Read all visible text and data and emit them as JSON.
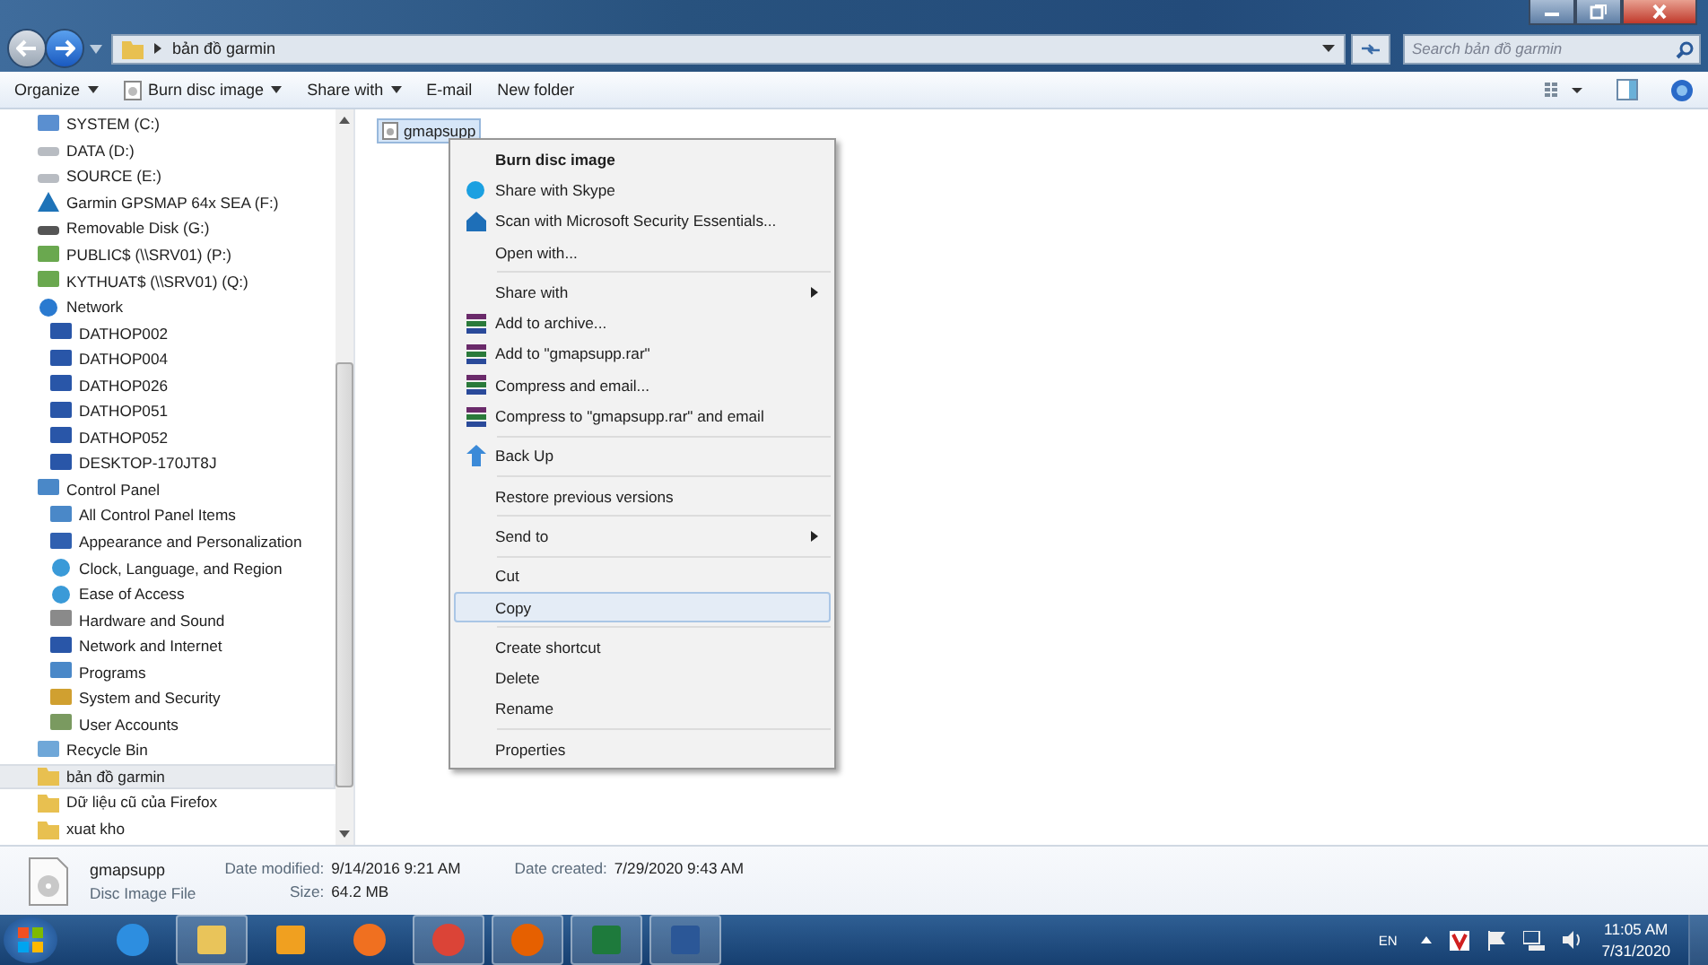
{
  "address": {
    "crumb": "bản đồ garmin",
    "search_placeholder": "Search bản đồ garmin"
  },
  "toolbar": [
    {
      "label": "Organize",
      "dropdown": true,
      "icon": false
    },
    {
      "label": "Burn disc image",
      "dropdown": true,
      "icon": true
    },
    {
      "label": "Share with",
      "dropdown": true,
      "icon": false
    },
    {
      "label": "E-mail",
      "dropdown": false,
      "icon": false
    },
    {
      "label": "New folder",
      "dropdown": false,
      "icon": false
    }
  ],
  "nav": [
    {
      "label": "SYSTEM (C:)",
      "kind": "system",
      "selected": false
    },
    {
      "label": "DATA (D:)",
      "kind": "drive",
      "selected": false
    },
    {
      "label": "SOURCE (E:)",
      "kind": "drive",
      "selected": false
    },
    {
      "label": "Garmin GPSMAP 64x SEA (F:)",
      "kind": "device",
      "selected": false
    },
    {
      "label": "Removable Disk (G:)",
      "kind": "removable",
      "selected": false
    },
    {
      "label": "PUBLIC$ (\\\\SRV01) (P:)",
      "kind": "netdrive",
      "selected": false
    },
    {
      "label": "KYTHUAT$ (\\\\SRV01) (Q:)",
      "kind": "netdrive",
      "selected": false
    },
    {
      "label": "Network",
      "kind": "network",
      "selected": false,
      "children": [
        {
          "label": "DATHOP002",
          "kind": "computer",
          "selected": false
        },
        {
          "label": "DATHOP004",
          "kind": "computer",
          "selected": false
        },
        {
          "label": "DATHOP026",
          "kind": "computer",
          "selected": false
        },
        {
          "label": "DATHOP051",
          "kind": "computer",
          "selected": false
        },
        {
          "label": "DATHOP052",
          "kind": "computer",
          "selected": false
        },
        {
          "label": "DESKTOP-170JT8J",
          "kind": "computer",
          "selected": false
        }
      ]
    },
    {
      "label": "Control Panel",
      "kind": "panel",
      "selected": false,
      "children": [
        {
          "label": "All Control Panel Items",
          "kind": "panel",
          "selected": false
        },
        {
          "label": "Appearance and Personalization",
          "kind": "appearance",
          "selected": false
        },
        {
          "label": "Clock, Language, and Region",
          "kind": "globe",
          "selected": false
        },
        {
          "label": "Ease of Access",
          "kind": "globe",
          "selected": false
        },
        {
          "label": "Hardware and Sound",
          "kind": "printer",
          "selected": false
        },
        {
          "label": "Network and Internet",
          "kind": "computer",
          "selected": false
        },
        {
          "label": "Programs",
          "kind": "panel",
          "selected": false
        },
        {
          "label": "System and Security",
          "kind": "shield",
          "selected": false
        },
        {
          "label": "User Accounts",
          "kind": "users",
          "selected": false
        }
      ]
    },
    {
      "label": "Recycle Bin",
      "kind": "recycle",
      "selected": false
    },
    {
      "label": "bản đồ garmin",
      "kind": "folder",
      "selected": true
    },
    {
      "label": "Dữ liệu cũ của Firefox",
      "kind": "folder",
      "selected": false
    },
    {
      "label": "xuat kho",
      "kind": "folder",
      "selected": false
    }
  ],
  "file": {
    "name": "gmapsupp",
    "selected": true
  },
  "menu": [
    [
      {
        "label": "Burn disc image",
        "kind": "plain",
        "default": true,
        "submenu": false,
        "selected": false
      },
      {
        "label": "Share with Skype",
        "kind": "skype",
        "default": false,
        "submenu": false,
        "selected": false
      },
      {
        "label": "Scan with Microsoft Security Essentials...",
        "kind": "house",
        "default": false,
        "submenu": false,
        "selected": false
      },
      {
        "label": "Open with...",
        "kind": "plain",
        "default": false,
        "submenu": false,
        "selected": false
      }
    ],
    [
      {
        "label": "Share with",
        "kind": "plain",
        "default": false,
        "submenu": true,
        "selected": false
      },
      {
        "label": "Add to archive...",
        "kind": "books",
        "default": false,
        "submenu": false,
        "selected": false
      },
      {
        "label": "Add to \"gmapsupp.rar\"",
        "kind": "books",
        "default": false,
        "submenu": false,
        "selected": false
      },
      {
        "label": "Compress and email...",
        "kind": "books",
        "default": false,
        "submenu": false,
        "selected": false
      },
      {
        "label": "Compress to \"gmapsupp.rar\" and email",
        "kind": "books",
        "default": false,
        "submenu": false,
        "selected": false
      }
    ],
    [
      {
        "label": "Back Up",
        "kind": "upload",
        "default": false,
        "submenu": false,
        "selected": false
      }
    ],
    [
      {
        "label": "Restore previous versions",
        "kind": "plain",
        "default": false,
        "submenu": false,
        "selected": false
      }
    ],
    [
      {
        "label": "Send to",
        "kind": "plain",
        "default": false,
        "submenu": true,
        "selected": false
      }
    ],
    [
      {
        "label": "Cut",
        "kind": "plain",
        "default": false,
        "submenu": false,
        "selected": false
      },
      {
        "label": "Copy",
        "kind": "plain",
        "default": false,
        "submenu": false,
        "selected": true
      }
    ],
    [
      {
        "label": "Create shortcut",
        "kind": "plain",
        "default": false,
        "submenu": false,
        "selected": false
      },
      {
        "label": "Delete",
        "kind": "plain",
        "default": false,
        "submenu": false,
        "selected": false
      },
      {
        "label": "Rename",
        "kind": "plain",
        "default": false,
        "submenu": false,
        "selected": false
      }
    ],
    [
      {
        "label": "Properties",
        "kind": "plain",
        "default": false,
        "submenu": false,
        "selected": false
      }
    ]
  ],
  "details": {
    "name": "gmapsupp",
    "type": "Disc Image File",
    "fields": [
      {
        "label": "Date modified:",
        "value": "9/14/2016 9:21 AM"
      },
      {
        "label": "Size:",
        "value": "64.2 MB"
      },
      {
        "label": "Date created:",
        "value": "7/29/2020 9:43 AM"
      }
    ]
  },
  "taskbar": {
    "apps": [
      {
        "kind": "ie",
        "running": false
      },
      {
        "kind": "explorer",
        "running": true
      },
      {
        "kind": "outlook",
        "running": false
      },
      {
        "kind": "media",
        "running": false
      },
      {
        "kind": "chrome",
        "running": true
      },
      {
        "kind": "firefox",
        "running": true
      },
      {
        "kind": "excel",
        "running": true
      },
      {
        "kind": "word",
        "running": true
      }
    ],
    "language": "EN",
    "time": "11:05 AM",
    "date": "7/31/2020"
  }
}
